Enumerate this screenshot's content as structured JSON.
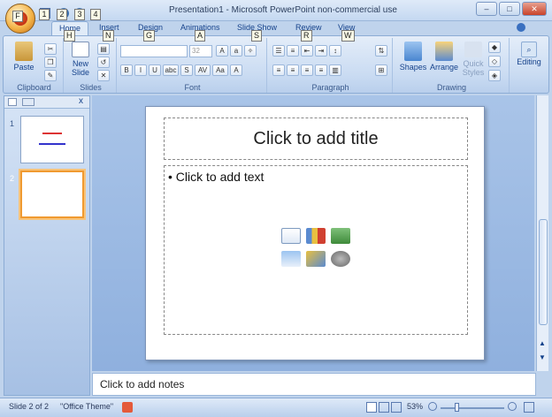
{
  "window": {
    "title": "Presentation1 - Microsoft PowerPoint non-commercial use"
  },
  "keytips": {
    "office": "F",
    "qat1": "1",
    "qat2": "2",
    "qat3": "3",
    "qat4": "4",
    "home": "H",
    "insert": "N",
    "design": "G",
    "animations": "A",
    "slideshow": "S",
    "review": "R",
    "view": "W"
  },
  "tabs": [
    "Home",
    "Insert",
    "Design",
    "Animations",
    "Slide Show",
    "Review",
    "View"
  ],
  "ribbon": {
    "clipboard": {
      "paste": "Paste",
      "label": "Clipboard"
    },
    "slides": {
      "new_slide_line1": "New",
      "new_slide_line2": "Slide",
      "label": "Slides"
    },
    "font": {
      "size": "32",
      "label": "Font",
      "bold": "B",
      "italic": "I",
      "underline": "U",
      "strike": "abc",
      "shadow": "S",
      "spacing": "AV",
      "case": "Aa",
      "color": "A"
    },
    "paragraph": {
      "label": "Paragraph"
    },
    "drawing": {
      "shapes": "Shapes",
      "arrange": "Arrange",
      "quick1": "Quick",
      "quick2": "Styles",
      "label": "Drawing"
    },
    "editing": {
      "label": "Editing"
    }
  },
  "slide_pane": {
    "tab_close": "x",
    "slide1_num": "1",
    "slide2_num": "2"
  },
  "slide": {
    "title_placeholder": "Click to add title",
    "body_placeholder": "Click to add text"
  },
  "notes": {
    "placeholder": "Click to add notes"
  },
  "status": {
    "slide": "Slide 2 of 2",
    "theme": "\"Office Theme\"",
    "zoom": "53%"
  },
  "colors": {
    "accent": "#15428b",
    "selected": "#f09a30"
  }
}
